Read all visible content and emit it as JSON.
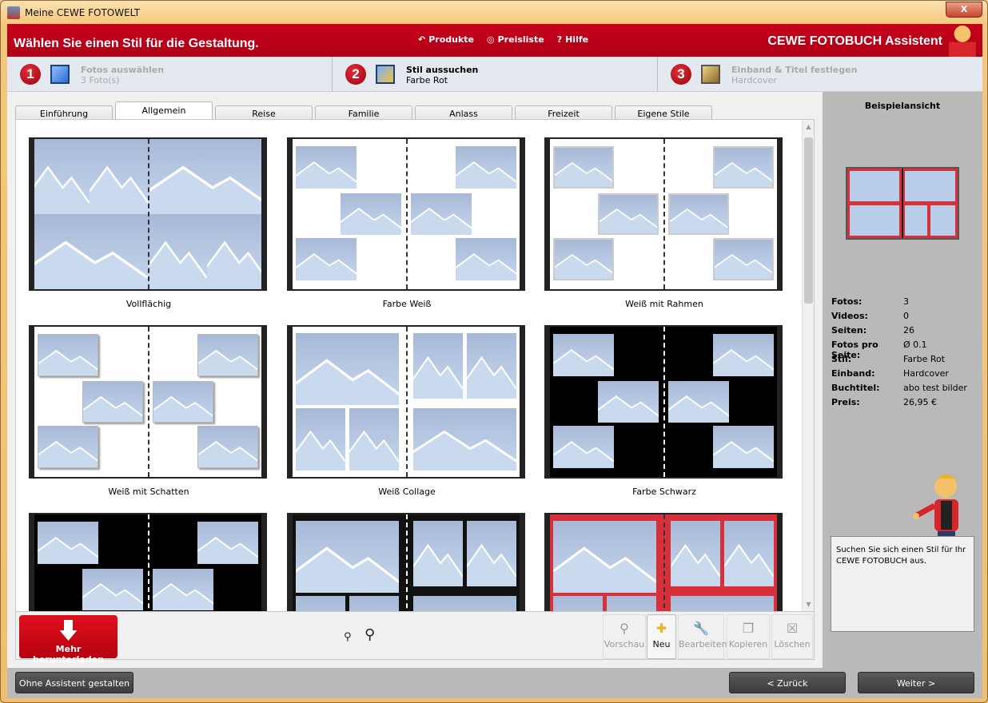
{
  "window": {
    "title": "Meine CEWE FOTOWELT",
    "close": "X"
  },
  "header": {
    "title": "Wählen Sie einen Stil für die Gestaltung.",
    "nav": [
      {
        "label": "Produkte",
        "icon": "↶"
      },
      {
        "label": "Preisliste",
        "icon": "◎"
      },
      {
        "label": "Hilfe",
        "icon": "?"
      }
    ],
    "brand": "CEWE FOTOBUCH Assistent"
  },
  "steps": [
    {
      "num": "1",
      "title": "Fotos auswählen",
      "sub": "3 Foto(s)"
    },
    {
      "num": "2",
      "title": "Stil aussuchen",
      "sub": "Farbe Rot"
    },
    {
      "num": "3",
      "title": "Einband & Titel festlegen",
      "sub": "Hardcover"
    }
  ],
  "tabs": [
    "Einführung",
    "Allgemein",
    "Reise",
    "Familie",
    "Anlass",
    "Freizeit",
    "Eigene Stile"
  ],
  "styles": [
    {
      "label": "Vollflächig"
    },
    {
      "label": "Farbe Weiß"
    },
    {
      "label": "Weiß mit Rahmen"
    },
    {
      "label": "Weiß mit Schatten"
    },
    {
      "label": "Weiß Collage"
    },
    {
      "label": "Farbe Schwarz"
    },
    {
      "label": ""
    },
    {
      "label": ""
    },
    {
      "label": ""
    }
  ],
  "toolbar": {
    "download": "Mehr herunterladen",
    "buttons": [
      {
        "label": "Vorschau",
        "icon": "⚲"
      },
      {
        "label": "Neu",
        "icon": "✚"
      },
      {
        "label": "Bearbeiten",
        "icon": "🔧"
      },
      {
        "label": "Kopieren",
        "icon": "❐"
      },
      {
        "label": "Löschen",
        "icon": "☒"
      }
    ]
  },
  "preview": {
    "title": "Beispielansicht"
  },
  "stats": [
    {
      "k": "Fotos:",
      "v": "3"
    },
    {
      "k": "Videos:",
      "v": "0"
    },
    {
      "k": "Seiten:",
      "v": "26"
    },
    {
      "k": "Fotos pro Seite:",
      "v": "Ø 0.1"
    },
    {
      "k": "Stil:",
      "v": "Farbe Rot"
    },
    {
      "k": "Einband:",
      "v": "Hardcover"
    },
    {
      "k": "Buchtitel:",
      "v": "abo test bilder"
    },
    {
      "k": "Preis:",
      "v": "26,95 €"
    }
  ],
  "hint": "Suchen Sie sich einen Stil für Ihr CEWE FOTOBUCH aus.",
  "footer": {
    "no_assistant": "Ohne Assistent gestalten",
    "back": "< Zurück",
    "next": "Weiter >"
  },
  "colors": {
    "brand_red": "#c0001a"
  }
}
